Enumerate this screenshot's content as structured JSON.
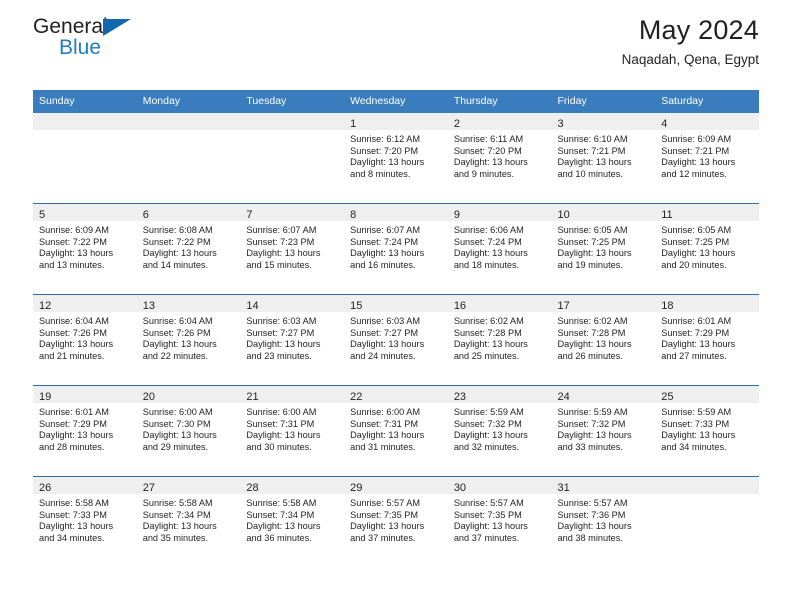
{
  "brand": {
    "name_part1": "General",
    "name_part2": "Blue",
    "triangle_color": "#1168ad",
    "blue": "#1f7fc4"
  },
  "header": {
    "title": "May 2024",
    "subtitle": "Naqadah, Qena, Egypt"
  },
  "theme": {
    "header_blue": "#3a7dbf",
    "separator_blue": "#2d6ca8",
    "daynum_band": "#efefef",
    "text": "#231f20"
  },
  "weekday_headers": [
    "Sunday",
    "Monday",
    "Tuesday",
    "Wednesday",
    "Thursday",
    "Friday",
    "Saturday"
  ],
  "weeks": [
    [
      {
        "day": "",
        "empty": true
      },
      {
        "day": "",
        "empty": true
      },
      {
        "day": "",
        "empty": true
      },
      {
        "day": "1",
        "sunrise": "Sunrise: 6:12 AM",
        "sunset": "Sunset: 7:20 PM",
        "daylight1": "Daylight: 13 hours",
        "daylight2": "and 8 minutes."
      },
      {
        "day": "2",
        "sunrise": "Sunrise: 6:11 AM",
        "sunset": "Sunset: 7:20 PM",
        "daylight1": "Daylight: 13 hours",
        "daylight2": "and 9 minutes."
      },
      {
        "day": "3",
        "sunrise": "Sunrise: 6:10 AM",
        "sunset": "Sunset: 7:21 PM",
        "daylight1": "Daylight: 13 hours",
        "daylight2": "and 10 minutes."
      },
      {
        "day": "4",
        "sunrise": "Sunrise: 6:09 AM",
        "sunset": "Sunset: 7:21 PM",
        "daylight1": "Daylight: 13 hours",
        "daylight2": "and 12 minutes."
      }
    ],
    [
      {
        "day": "5",
        "sunrise": "Sunrise: 6:09 AM",
        "sunset": "Sunset: 7:22 PM",
        "daylight1": "Daylight: 13 hours",
        "daylight2": "and 13 minutes."
      },
      {
        "day": "6",
        "sunrise": "Sunrise: 6:08 AM",
        "sunset": "Sunset: 7:22 PM",
        "daylight1": "Daylight: 13 hours",
        "daylight2": "and 14 minutes."
      },
      {
        "day": "7",
        "sunrise": "Sunrise: 6:07 AM",
        "sunset": "Sunset: 7:23 PM",
        "daylight1": "Daylight: 13 hours",
        "daylight2": "and 15 minutes."
      },
      {
        "day": "8",
        "sunrise": "Sunrise: 6:07 AM",
        "sunset": "Sunset: 7:24 PM",
        "daylight1": "Daylight: 13 hours",
        "daylight2": "and 16 minutes."
      },
      {
        "day": "9",
        "sunrise": "Sunrise: 6:06 AM",
        "sunset": "Sunset: 7:24 PM",
        "daylight1": "Daylight: 13 hours",
        "daylight2": "and 18 minutes."
      },
      {
        "day": "10",
        "sunrise": "Sunrise: 6:05 AM",
        "sunset": "Sunset: 7:25 PM",
        "daylight1": "Daylight: 13 hours",
        "daylight2": "and 19 minutes."
      },
      {
        "day": "11",
        "sunrise": "Sunrise: 6:05 AM",
        "sunset": "Sunset: 7:25 PM",
        "daylight1": "Daylight: 13 hours",
        "daylight2": "and 20 minutes."
      }
    ],
    [
      {
        "day": "12",
        "sunrise": "Sunrise: 6:04 AM",
        "sunset": "Sunset: 7:26 PM",
        "daylight1": "Daylight: 13 hours",
        "daylight2": "and 21 minutes."
      },
      {
        "day": "13",
        "sunrise": "Sunrise: 6:04 AM",
        "sunset": "Sunset: 7:26 PM",
        "daylight1": "Daylight: 13 hours",
        "daylight2": "and 22 minutes."
      },
      {
        "day": "14",
        "sunrise": "Sunrise: 6:03 AM",
        "sunset": "Sunset: 7:27 PM",
        "daylight1": "Daylight: 13 hours",
        "daylight2": "and 23 minutes."
      },
      {
        "day": "15",
        "sunrise": "Sunrise: 6:03 AM",
        "sunset": "Sunset: 7:27 PM",
        "daylight1": "Daylight: 13 hours",
        "daylight2": "and 24 minutes."
      },
      {
        "day": "16",
        "sunrise": "Sunrise: 6:02 AM",
        "sunset": "Sunset: 7:28 PM",
        "daylight1": "Daylight: 13 hours",
        "daylight2": "and 25 minutes."
      },
      {
        "day": "17",
        "sunrise": "Sunrise: 6:02 AM",
        "sunset": "Sunset: 7:28 PM",
        "daylight1": "Daylight: 13 hours",
        "daylight2": "and 26 minutes."
      },
      {
        "day": "18",
        "sunrise": "Sunrise: 6:01 AM",
        "sunset": "Sunset: 7:29 PM",
        "daylight1": "Daylight: 13 hours",
        "daylight2": "and 27 minutes."
      }
    ],
    [
      {
        "day": "19",
        "sunrise": "Sunrise: 6:01 AM",
        "sunset": "Sunset: 7:29 PM",
        "daylight1": "Daylight: 13 hours",
        "daylight2": "and 28 minutes."
      },
      {
        "day": "20",
        "sunrise": "Sunrise: 6:00 AM",
        "sunset": "Sunset: 7:30 PM",
        "daylight1": "Daylight: 13 hours",
        "daylight2": "and 29 minutes."
      },
      {
        "day": "21",
        "sunrise": "Sunrise: 6:00 AM",
        "sunset": "Sunset: 7:31 PM",
        "daylight1": "Daylight: 13 hours",
        "daylight2": "and 30 minutes."
      },
      {
        "day": "22",
        "sunrise": "Sunrise: 6:00 AM",
        "sunset": "Sunset: 7:31 PM",
        "daylight1": "Daylight: 13 hours",
        "daylight2": "and 31 minutes."
      },
      {
        "day": "23",
        "sunrise": "Sunrise: 5:59 AM",
        "sunset": "Sunset: 7:32 PM",
        "daylight1": "Daylight: 13 hours",
        "daylight2": "and 32 minutes."
      },
      {
        "day": "24",
        "sunrise": "Sunrise: 5:59 AM",
        "sunset": "Sunset: 7:32 PM",
        "daylight1": "Daylight: 13 hours",
        "daylight2": "and 33 minutes."
      },
      {
        "day": "25",
        "sunrise": "Sunrise: 5:59 AM",
        "sunset": "Sunset: 7:33 PM",
        "daylight1": "Daylight: 13 hours",
        "daylight2": "and 34 minutes."
      }
    ],
    [
      {
        "day": "26",
        "sunrise": "Sunrise: 5:58 AM",
        "sunset": "Sunset: 7:33 PM",
        "daylight1": "Daylight: 13 hours",
        "daylight2": "and 34 minutes."
      },
      {
        "day": "27",
        "sunrise": "Sunrise: 5:58 AM",
        "sunset": "Sunset: 7:34 PM",
        "daylight1": "Daylight: 13 hours",
        "daylight2": "and 35 minutes."
      },
      {
        "day": "28",
        "sunrise": "Sunrise: 5:58 AM",
        "sunset": "Sunset: 7:34 PM",
        "daylight1": "Daylight: 13 hours",
        "daylight2": "and 36 minutes."
      },
      {
        "day": "29",
        "sunrise": "Sunrise: 5:57 AM",
        "sunset": "Sunset: 7:35 PM",
        "daylight1": "Daylight: 13 hours",
        "daylight2": "and 37 minutes."
      },
      {
        "day": "30",
        "sunrise": "Sunrise: 5:57 AM",
        "sunset": "Sunset: 7:35 PM",
        "daylight1": "Daylight: 13 hours",
        "daylight2": "and 37 minutes."
      },
      {
        "day": "31",
        "sunrise": "Sunrise: 5:57 AM",
        "sunset": "Sunset: 7:36 PM",
        "daylight1": "Daylight: 13 hours",
        "daylight2": "and 38 minutes."
      },
      {
        "day": "",
        "empty": true
      }
    ]
  ]
}
